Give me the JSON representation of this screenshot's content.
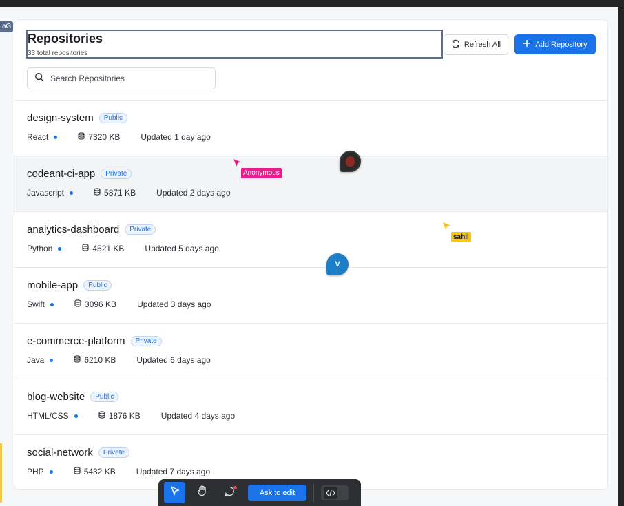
{
  "app": {
    "left_tag": "aG"
  },
  "header": {
    "title": "Repositories",
    "subtitle": "33 total repositories",
    "refresh_label": "Refresh All",
    "add_label": "Add Repository"
  },
  "search": {
    "placeholder": "Search Repositories",
    "value": ""
  },
  "repositories": [
    {
      "name": "design-system",
      "visibility": "Public",
      "language": "React",
      "size": "7320 KB",
      "updated": "Updated 1 day ago"
    },
    {
      "name": "codeant-ci-app",
      "visibility": "Private",
      "language": "Javascript",
      "size": "5871 KB",
      "updated": "Updated 2 days ago"
    },
    {
      "name": "analytics-dashboard",
      "visibility": "Private",
      "language": "Python",
      "size": "4521 KB",
      "updated": "Updated 5 days ago"
    },
    {
      "name": "mobile-app",
      "visibility": "Public",
      "language": "Swift",
      "size": "3096 KB",
      "updated": "Updated 3 days ago"
    },
    {
      "name": "e-commerce-platform",
      "visibility": "Private",
      "language": "Java",
      "size": "6210 KB",
      "updated": "Updated 6 days ago"
    },
    {
      "name": "blog-website",
      "visibility": "Public",
      "language": "HTML/CSS",
      "size": "1876 KB",
      "updated": "Updated 4 days ago"
    },
    {
      "name": "social-network",
      "visibility": "Private",
      "language": "PHP",
      "size": "5432 KB",
      "updated": "Updated 7 days ago"
    }
  ],
  "collaborators": {
    "anonymous_label": "Anonymous",
    "sahil_label": "sahil",
    "v_initial": "V"
  },
  "toolbar": {
    "ask_label": "Ask to edit",
    "tools": [
      "select-pointer-icon",
      "hand-icon",
      "comment-icon",
      "code-icon"
    ]
  },
  "colors": {
    "accent": "#1a73e8",
    "anonymous_cursor": "#e91e8c",
    "sahil_cursor": "#f5c518",
    "v_avatar": "#1e7fc6"
  }
}
